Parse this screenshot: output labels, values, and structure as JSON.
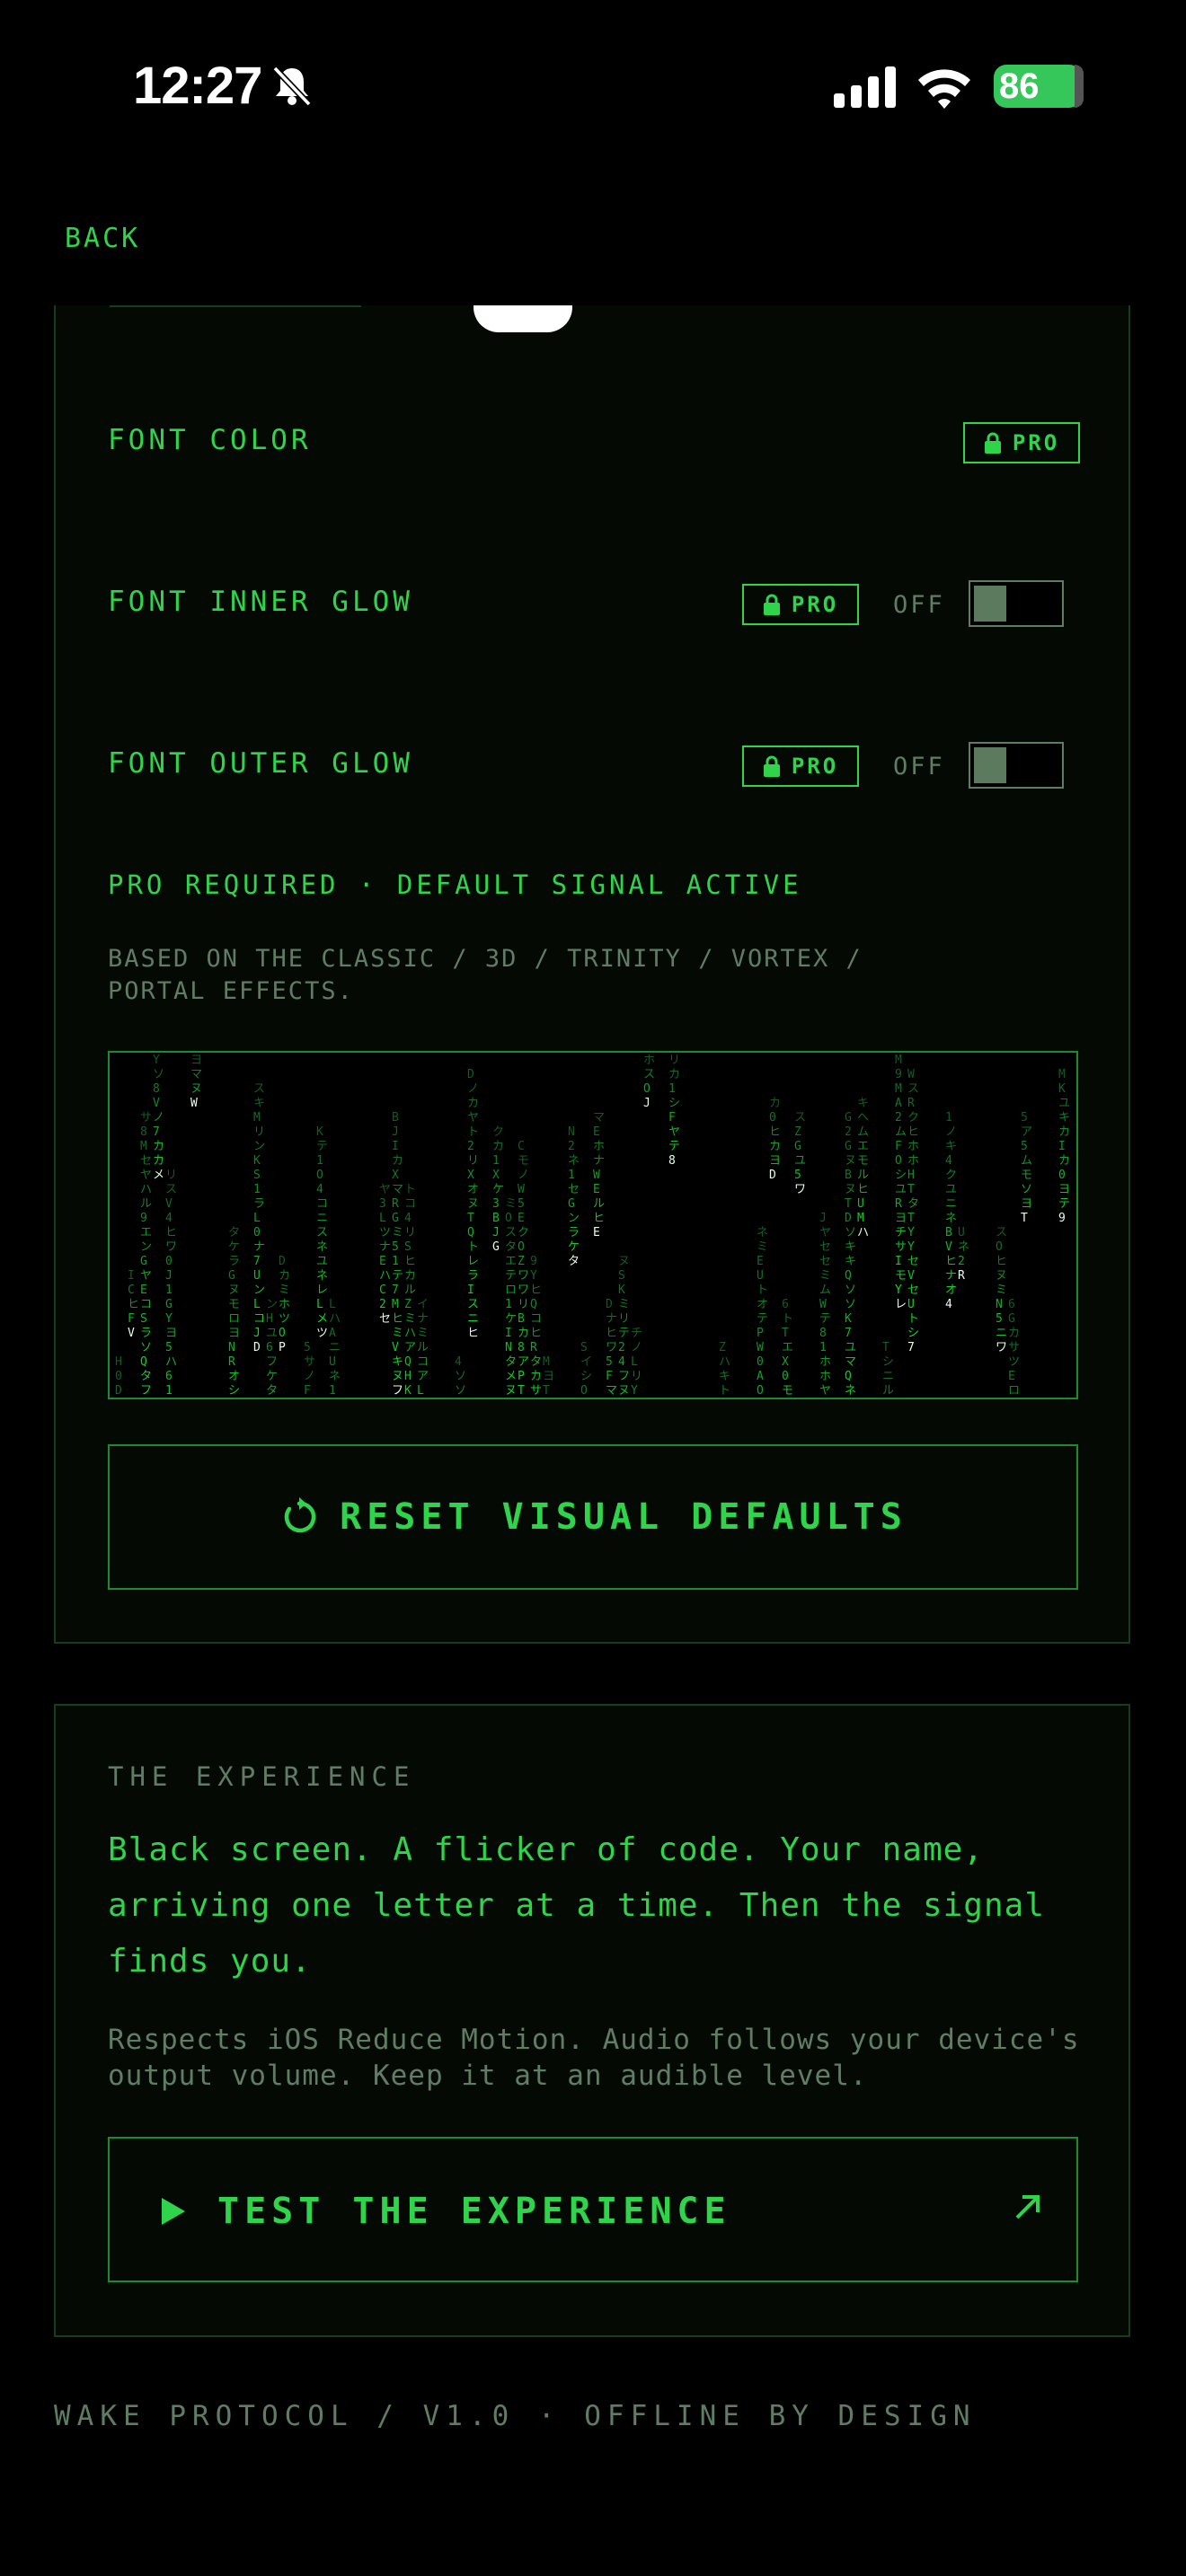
{
  "status_bar": {
    "time": "12:27",
    "battery": "86"
  },
  "nav": {
    "back_label": "BACK"
  },
  "settings": {
    "font_color_label": "FONT COLOR",
    "font_inner_glow_label": "FONT INNER GLOW",
    "font_outer_glow_label": "FONT OUTER GLOW",
    "pro_label": "PRO",
    "inner_glow_state": "OFF",
    "outer_glow_state": "OFF",
    "notice": "PRO REQUIRED · DEFAULT SIGNAL ACTIVE",
    "description": "BASED ON THE CLASSIC / 3D / TRINITY / VORTEX / PORTAL EFFECTS.",
    "reset_label": "RESET VISUAL DEFAULTS"
  },
  "experience": {
    "title": "THE EXPERIENCE",
    "body": "Black screen. A flicker of code. Your name, arriving one letter at a time. Then the signal finds you.",
    "note": "Respects iOS Reduce Motion. Audio follows your device's output volume. Keep it at an audible level.",
    "test_label": "TEST THE EXPERIENCE"
  },
  "footer": {
    "text": "WAKE PROTOCOL / V1.0 · OFFLINE BY DESIGN"
  },
  "colors": {
    "accent": "#2fd44a",
    "muted": "#5f7d64",
    "border": "#163d1c"
  },
  "icons": [
    "bell-slash-icon",
    "cellular-signal-icon",
    "wifi-icon",
    "battery-icon",
    "lock-icon",
    "reset-icon",
    "play-icon",
    "arrow-up-right-icon"
  ]
}
